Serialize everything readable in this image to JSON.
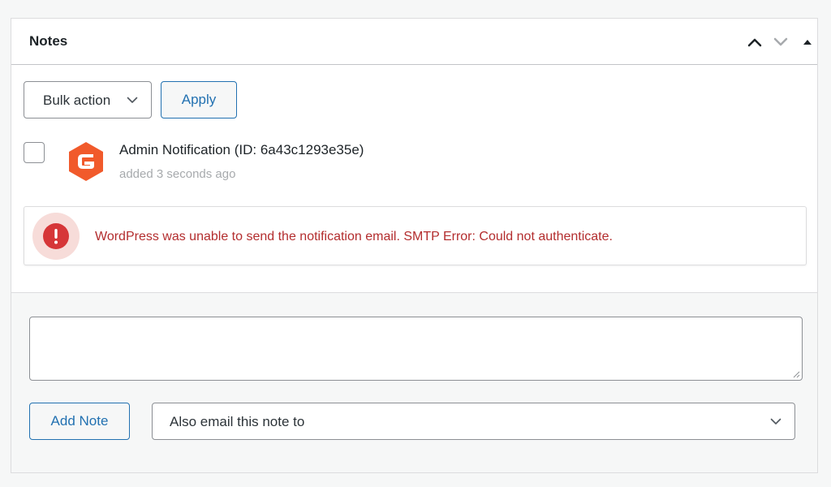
{
  "panel": {
    "title": "Notes",
    "controls": {
      "move_up": "chevron-up-icon",
      "move_down": "chevron-down-icon",
      "toggle": "triangle-up-icon"
    }
  },
  "toolbar": {
    "bulk_action_label": "Bulk action",
    "apply_label": "Apply"
  },
  "notes": [
    {
      "title": "Admin Notification (ID: 6a43c1293e35e)",
      "meta": "added 3 seconds ago",
      "avatar_icon": "gravity-forms-logo-icon",
      "checked": false
    }
  ],
  "error": {
    "icon": "exclamation-icon",
    "message": "WordPress was unable to send the notification email. SMTP Error: Could not authenticate.",
    "color": "#b32d2e"
  },
  "composer": {
    "textarea_value": "",
    "add_note_label": "Add Note",
    "email_select_label": "Also email this note to"
  },
  "colors": {
    "accent": "#2271b1",
    "logo": "#f15a2b",
    "error_bg": "#f7dcd9",
    "error_icon": "#d63638"
  }
}
